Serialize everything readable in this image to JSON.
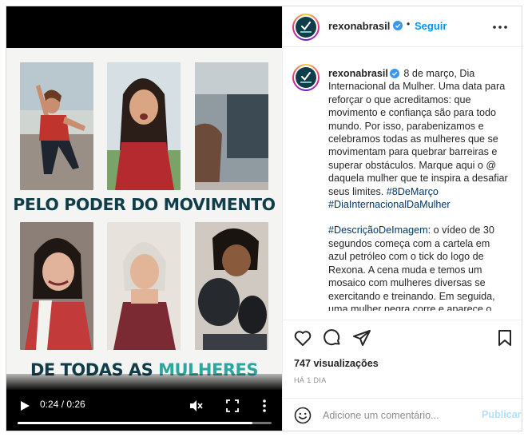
{
  "post": {
    "username": "rexonabrasil",
    "follow_label": "Seguir",
    "separator": "•"
  },
  "video": {
    "headline_line1": "PELO PODER DO MOVIMENTO",
    "headline_line2_prefix": "DE TODAS AS ",
    "headline_line2_accent": "MULHERES",
    "current_time": "0:24",
    "duration": "0:26",
    "time_display": "0:24 / 0:26",
    "progress_fraction": 0.923,
    "muted": true
  },
  "caption": {
    "username": "rexonabrasil",
    "text_part1": "8 de março, Dia Internacional da Mulher. Uma data para reforçar o que acreditamos: que movimento e confiança são para todo mundo. Por isso, parabenizamos e celebramos todas as mulheres que se movimentam para quebrar barreiras e superar obstáculos. Marque aqui o @ daquela mulher que te inspira a desafiar seus limites.",
    "hashtag1": "#8DeMarço",
    "hashtag2": "#DiaInternacionalDaMulher",
    "hashtag3": "#DescriçãoDeImagem",
    "text_part2": ": o vídeo de 30 segundos começa com a cartela em azul petróleo com o tick do logo de Rexona. A cena muda e temos um mosaico com mulheres diversas se exercitando e treinando. Em seguida, uma mulher negra corre e aparece o texto: \"O"
  },
  "stats": {
    "views": "747 visualizações",
    "time_ago": "HÁ 1 DIA"
  },
  "comment": {
    "placeholder": "Adicione um comentário...",
    "publish_label": "Publicar"
  },
  "icons": {
    "verified": "verified-badge-icon",
    "like": "heart-icon",
    "comment": "comment-bubble-icon",
    "share": "paper-plane-icon",
    "save": "bookmark-icon",
    "emoji": "smiley-icon",
    "play": "play-icon",
    "mute": "speaker-muted-icon",
    "fullscreen": "fullscreen-icon",
    "more": "more-options-icon"
  },
  "colors": {
    "brand_teal": "#0f3d4a",
    "accent_teal": "#2aa7a0",
    "link_blue": "#0095f6",
    "hashtag_blue": "#00376b"
  }
}
